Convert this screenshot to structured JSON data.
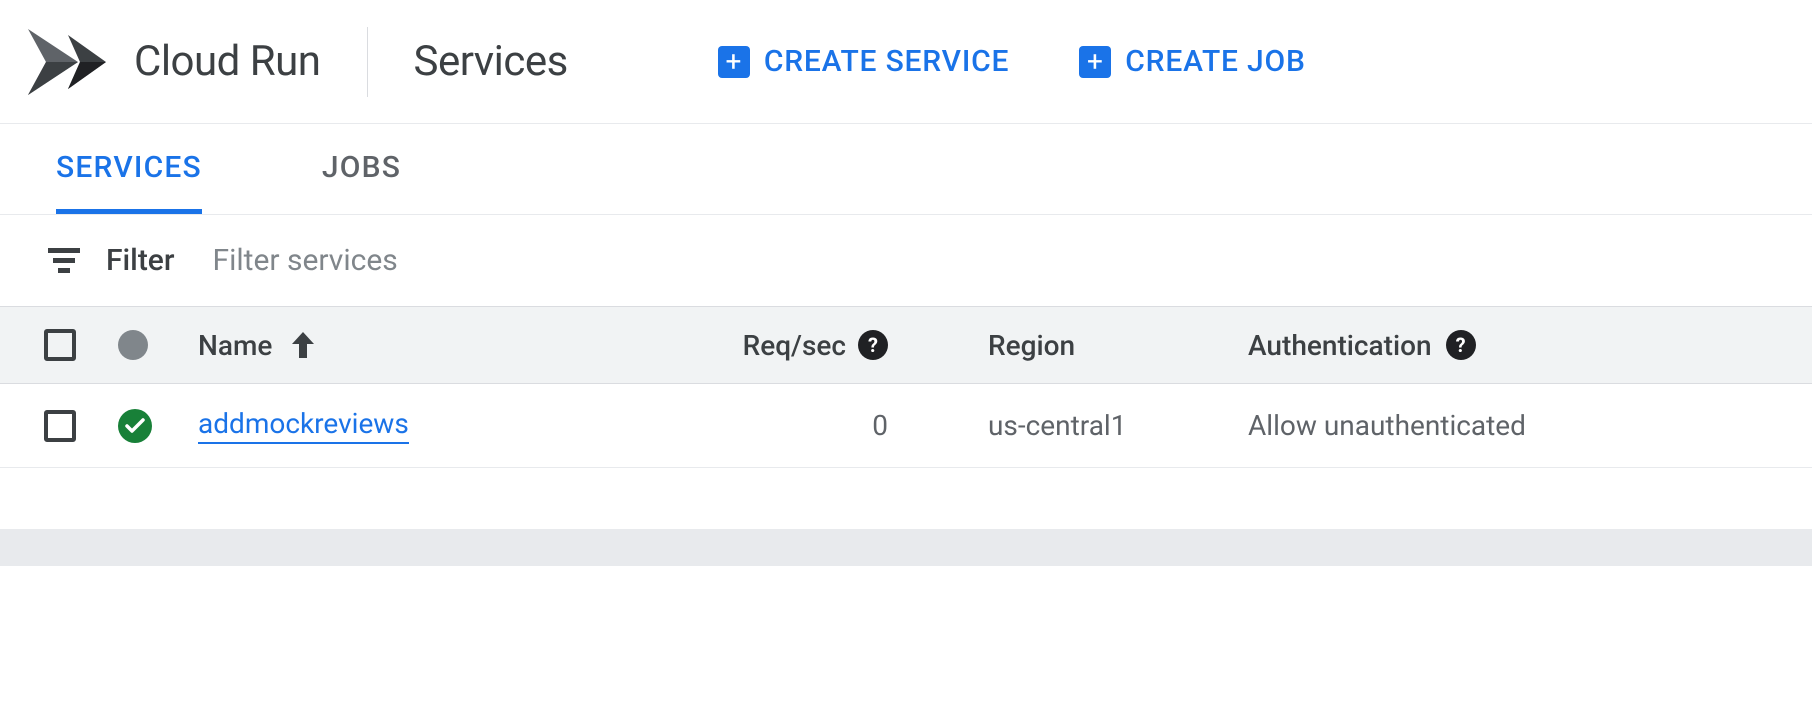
{
  "header": {
    "product": "Cloud Run",
    "page": "Services",
    "actions": {
      "create_service": "CREATE SERVICE",
      "create_job": "CREATE JOB"
    }
  },
  "tabs": {
    "services": "SERVICES",
    "jobs": "JOBS",
    "active": "services"
  },
  "filter": {
    "label": "Filter",
    "placeholder": "Filter services"
  },
  "table": {
    "columns": {
      "name": "Name",
      "req_sec": "Req/sec",
      "region": "Region",
      "auth": "Authentication"
    },
    "rows": [
      {
        "status": "ok",
        "name": "addmockreviews",
        "req_sec": "0",
        "region": "us-central1",
        "auth": "Allow unauthenticated"
      }
    ]
  }
}
